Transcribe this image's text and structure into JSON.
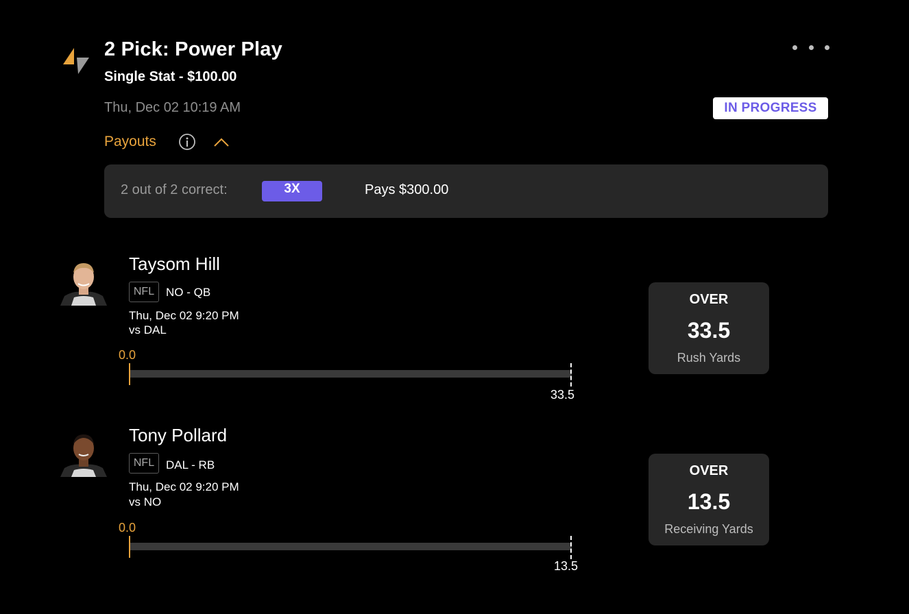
{
  "header": {
    "title": "2 Pick: Power Play",
    "subtitle": "Single Stat - $100.00",
    "timestamp": "Thu, Dec 02 10:19 AM",
    "status": "IN PROGRESS",
    "more_icon": "more-horizontal-icon"
  },
  "payouts": {
    "label": "Payouts",
    "info_icon": "info-icon",
    "toggle_icon": "chevron-up-icon",
    "rows": [
      {
        "condition": "2 out of 2 correct:",
        "multiplier": "3X",
        "pays": "Pays $300.00"
      }
    ]
  },
  "picks": [
    {
      "player": "Taysom Hill",
      "league": "NFL",
      "team_position": "NO - QB",
      "game_time": "Thu, Dec 02 9:20 PM",
      "opponent": "vs DAL",
      "current": "0.0",
      "current_value": 0,
      "target": "33.5",
      "target_value": 33.5,
      "direction": "OVER",
      "line": "33.5",
      "stat": "Rush Yards"
    },
    {
      "player": "Tony Pollard",
      "league": "NFL",
      "team_position": "DAL - RB",
      "game_time": "Thu, Dec 02 9:20 PM",
      "opponent": "vs NO",
      "current": "0.0",
      "current_value": 0,
      "target": "13.5",
      "target_value": 13.5,
      "direction": "OVER",
      "line": "13.5",
      "stat": "Receiving Yards"
    }
  ],
  "colors": {
    "accent_orange": "#e8a33c",
    "accent_purple": "#6c5ce7",
    "panel": "#272727",
    "background": "#000000"
  }
}
